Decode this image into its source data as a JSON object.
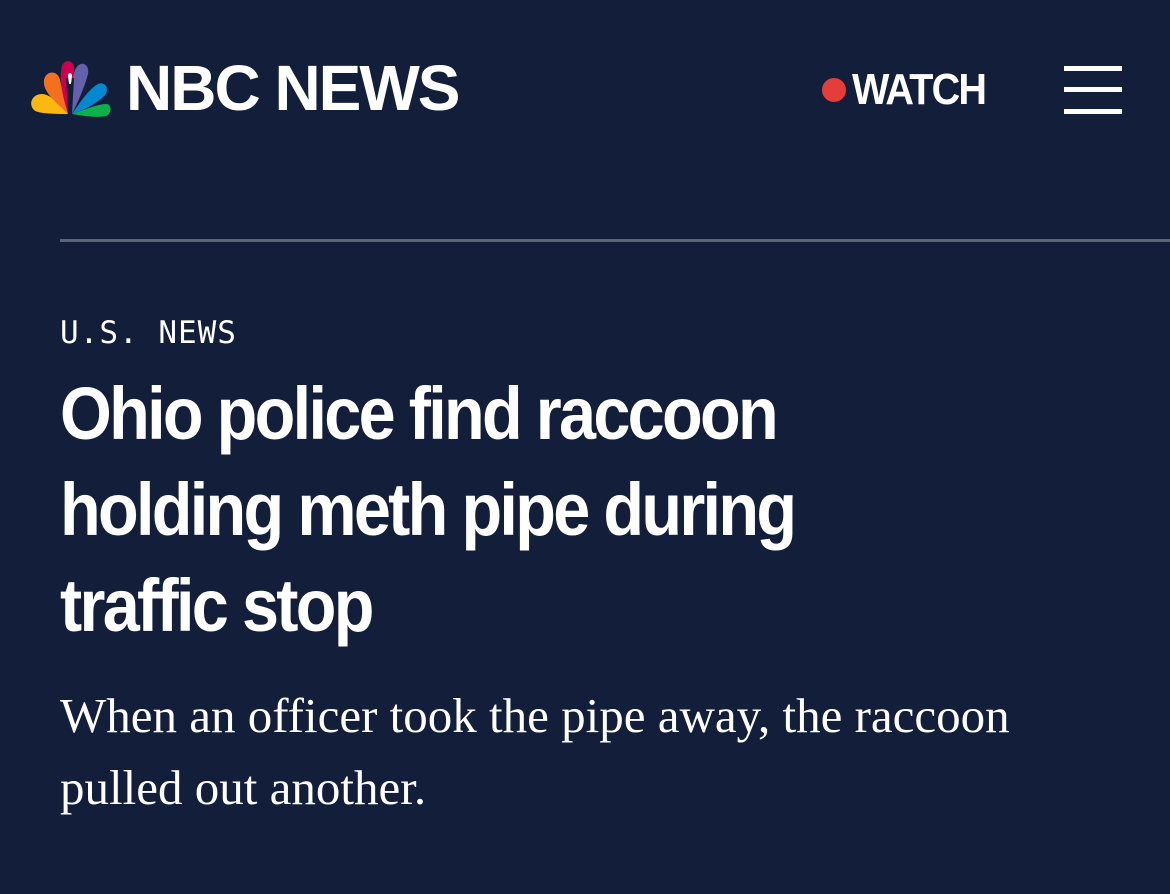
{
  "header": {
    "logo_text": "NBC NEWS",
    "watch_label": "WATCH",
    "live_dot_color": "#e53d3a",
    "menu_icon": "hamburger-menu-icon"
  },
  "article": {
    "section": "U.S. NEWS",
    "headline_lines": [
      "Ohio police find raccoon",
      "holding meth pipe during",
      "traffic stop"
    ],
    "subheadline": "When an officer took the pipe away, the raccoon pulled out another."
  },
  "colors": {
    "background": "#131e3a",
    "text": "#ffffff",
    "divider": "#5b6478"
  }
}
